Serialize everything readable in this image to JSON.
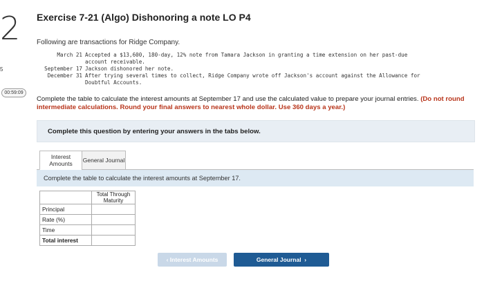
{
  "side": {
    "question_number": "2",
    "tick": "5",
    "timer": "00:59:09"
  },
  "title": "Exercise 7-21 (Algo) Dishonoring a note LO P4",
  "intro": "Following are transactions for Ridge Company.",
  "transactions": [
    {
      "date": "March 21",
      "text": "Accepted a $13,600, 180-day, 12% note from Tamara Jackson in granting a time extension on her past-due"
    },
    {
      "date": "",
      "text": "account receivable."
    },
    {
      "date": "September 17",
      "text": "Jackson dishonored her note."
    },
    {
      "date": "December 31",
      "text": "After trying several times to collect, Ridge Company wrote off Jackson's account against the Allowance for"
    },
    {
      "date": "",
      "text": "Doubtful Accounts."
    }
  ],
  "instructions": {
    "main": "Complete the table to calculate the interest amounts at September 17 and use the calculated value to prepare your journal entries. ",
    "emphasis": "(Do not round intermediate calculations. Round your final answers to nearest whole dollar. Use 360 days a year.)"
  },
  "panel_text": "Complete this question by entering your answers in the tabs below.",
  "tabs": [
    {
      "label": "Interest Amounts"
    },
    {
      "label": "General Journal"
    }
  ],
  "subpanel_text": "Complete the table to calculate the interest amounts at September 17.",
  "table": {
    "column_header": "Total Through Maturity",
    "rows": [
      {
        "label": "Principal",
        "value": ""
      },
      {
        "label": "Rate (%)",
        "value": ""
      },
      {
        "label": "Time",
        "value": ""
      },
      {
        "label": "Total interest",
        "value": ""
      }
    ]
  },
  "buttons": {
    "prev": "Interest Amounts",
    "next": "General Journal"
  }
}
